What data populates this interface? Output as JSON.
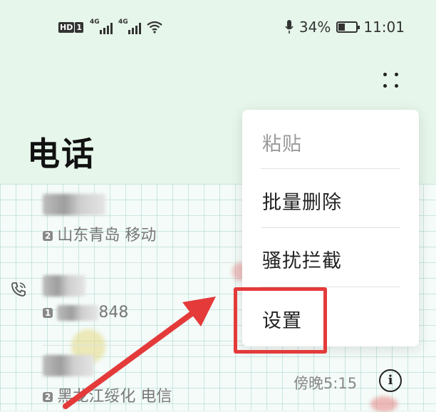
{
  "status_bar": {
    "hd_label": "HD",
    "sim1": "1",
    "net1": "4G",
    "net2": "4G",
    "battery_text": "34%",
    "battery_level": 0.34,
    "time": "11:01"
  },
  "header": {
    "title": "电话"
  },
  "calls": [
    {
      "sim": "2",
      "location": "山东青岛 移动"
    },
    {
      "sim": "1",
      "number_partial": "848"
    },
    {
      "sim": "2",
      "location": "黑龙江绥化 电信",
      "time": "傍晚5:15"
    }
  ],
  "menu": {
    "items": [
      {
        "label": "粘贴",
        "disabled": true
      },
      {
        "label": "批量删除"
      },
      {
        "label": "骚扰拦截"
      },
      {
        "label": "设置"
      }
    ]
  },
  "colors": {
    "highlight": "#e43a3a",
    "header_bg": "#e6f6ea"
  },
  "icons": [
    "more-vertical-icon",
    "phone-call-icon",
    "info-icon",
    "mic-icon",
    "wifi-icon",
    "battery-icon"
  ]
}
